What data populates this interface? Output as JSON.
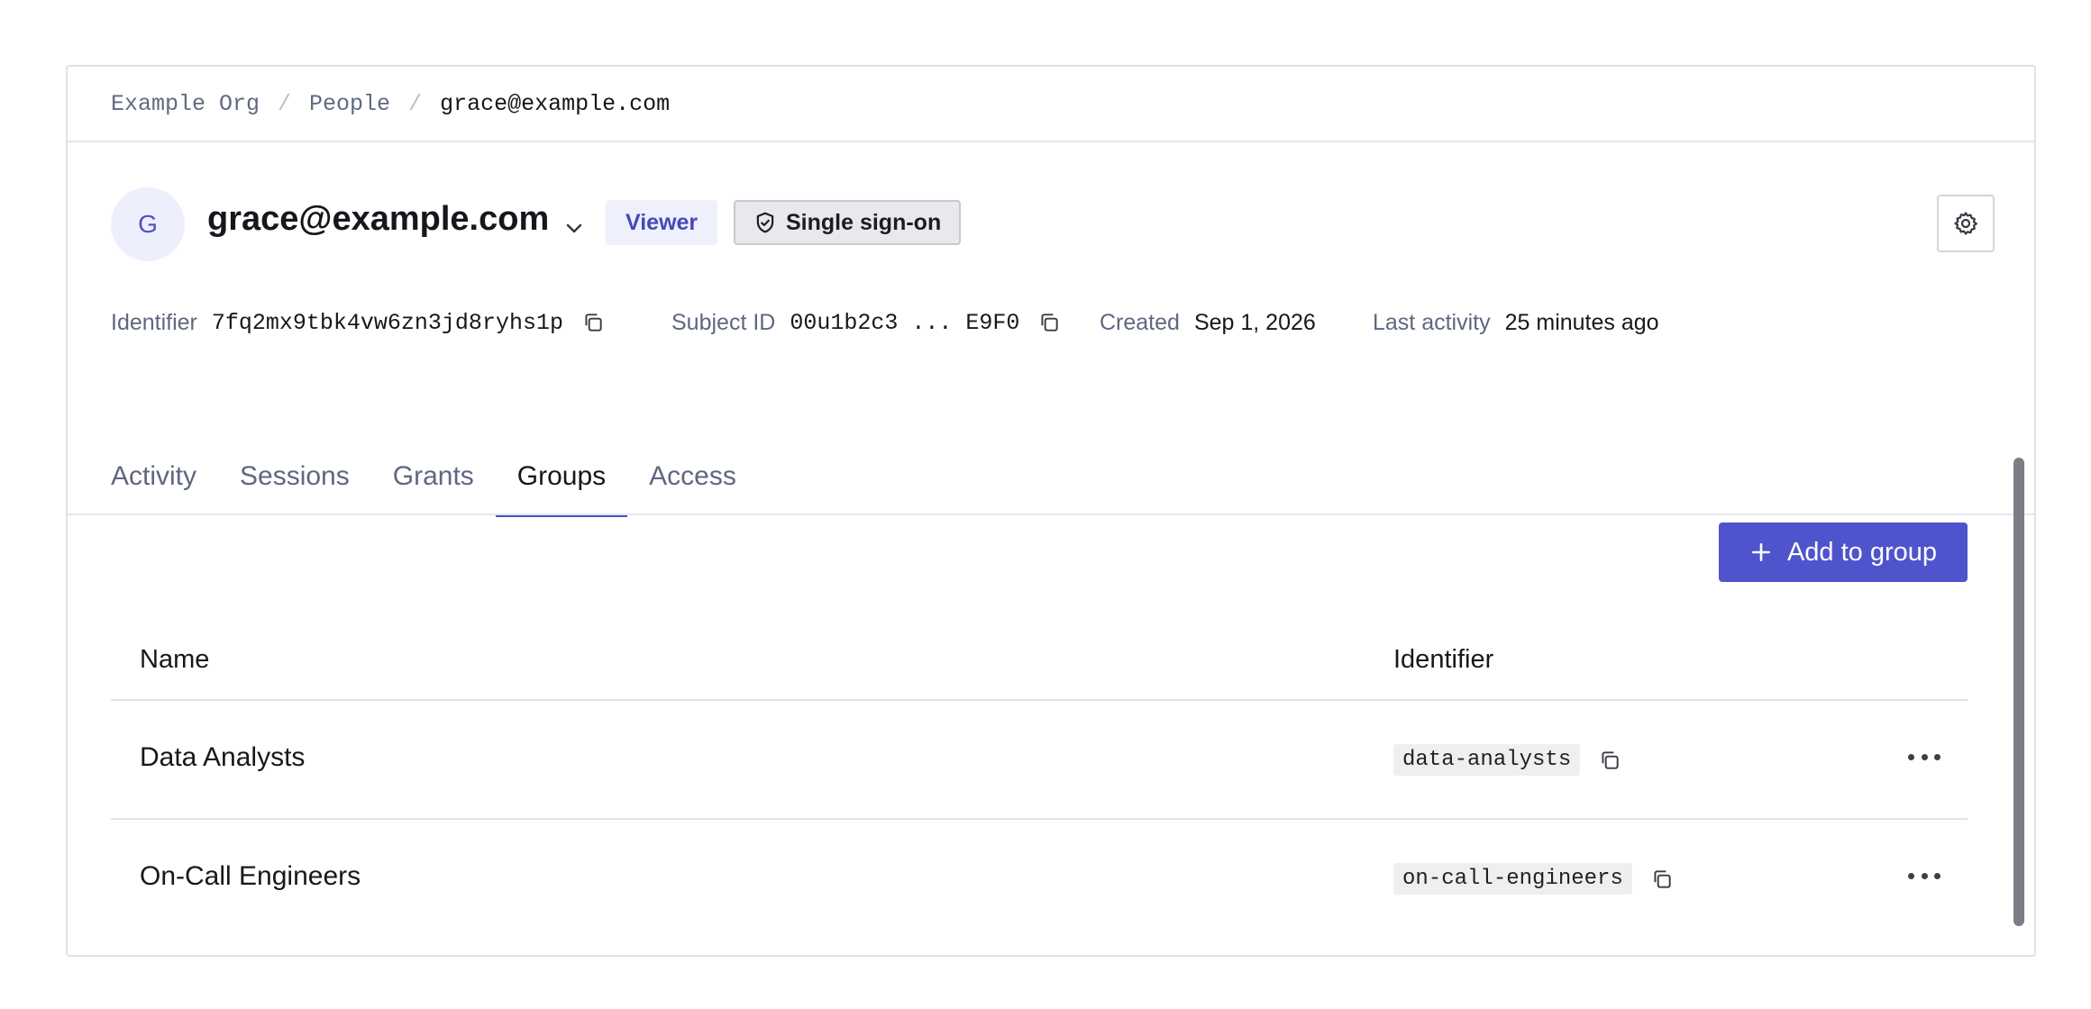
{
  "breadcrumb": {
    "items": [
      "Example Org",
      "People",
      "grace@example.com"
    ],
    "separator": "/"
  },
  "user": {
    "avatar_initial": "G",
    "email": "grace@example.com",
    "role": "Viewer",
    "auth_badge": "Single sign-on"
  },
  "meta": {
    "identifier_label": "Identifier",
    "identifier_value": "7fq2mx9tbk4vw6zn3jd8ryhs1p",
    "subject_label": "Subject ID",
    "subject_value": "00u1b2c3 ... E9F0",
    "created_label": "Created",
    "created_value": "Sep 1, 2026",
    "activity_label": "Last activity",
    "activity_value": "25 minutes ago"
  },
  "tabs": [
    {
      "label": "Activity",
      "active": false
    },
    {
      "label": "Sessions",
      "active": false
    },
    {
      "label": "Grants",
      "active": false
    },
    {
      "label": "Groups",
      "active": true
    },
    {
      "label": "Access",
      "active": false
    }
  ],
  "groups": {
    "add_button_label": "Add to group",
    "columns": {
      "name": "Name",
      "identifier": "Identifier"
    },
    "rows": [
      {
        "name": "Data Analysts",
        "identifier": "data-analysts"
      },
      {
        "name": "On-Call Engineers",
        "identifier": "on-call-engineers"
      }
    ]
  },
  "colors": {
    "accent": "#4f54cc",
    "role_badge_bg": "#eef0fc",
    "muted_text": "#5f6780"
  },
  "icons": {
    "copy": "copy-icon",
    "settings": "gear-icon",
    "expand": "chevron-down-icon",
    "sso": "shield-icon",
    "add": "plus-icon",
    "row_menu": "more-horizontal-icon"
  }
}
